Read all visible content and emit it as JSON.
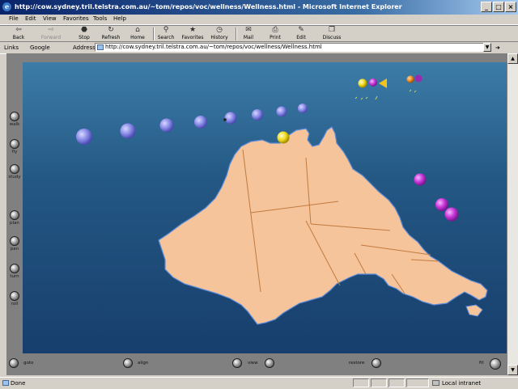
{
  "window": {
    "title": "http://cow.sydney.tril.telstra.com.au/~tom/repos/voc/wellness/Wellness.html - Microsoft Internet Explorer",
    "min": "_",
    "max": "□",
    "close": "×"
  },
  "menu": [
    "File",
    "Edit",
    "View",
    "Favorites",
    "Tools",
    "Help"
  ],
  "toolbar": {
    "back": "Back",
    "forward": "Forward",
    "stop": "Stop",
    "refresh": "Refresh",
    "home": "Home",
    "search": "Search",
    "favorites": "Favorites",
    "history": "History",
    "mail": "Mail",
    "print": "Print",
    "edit": "Edit",
    "discuss": "Discuss"
  },
  "addressbar": {
    "links_label": "Links",
    "google_label": "Google",
    "address_label": "Address",
    "url": "http://cow.sydney.tril.telstra.com.au/~tom/repos/voc/wellness/Wellness.html"
  },
  "side_controls": [
    "walk",
    "fly",
    "study",
    "plan",
    "pan",
    "turn",
    "roll"
  ],
  "bottom_controls": [
    "goto",
    "align",
    "view",
    "restore",
    "fit"
  ],
  "status": {
    "text": "Done",
    "zone": "Local intranet"
  },
  "colors": {
    "land": "#f6c49a",
    "sea_top": "#3d7ca8",
    "sea_bottom": "#173e6c",
    "sphere_blue": "#8a8be8",
    "sphere_magenta": "#c837d9",
    "sphere_yellow": "#f2dc1f"
  },
  "icons": [
    "ie-logo-icon",
    "back-icon",
    "forward-icon",
    "stop-icon",
    "refresh-icon",
    "home-icon",
    "search-icon",
    "favorites-icon",
    "history-icon",
    "mail-icon",
    "print-icon",
    "edit-icon",
    "discuss-icon"
  ]
}
